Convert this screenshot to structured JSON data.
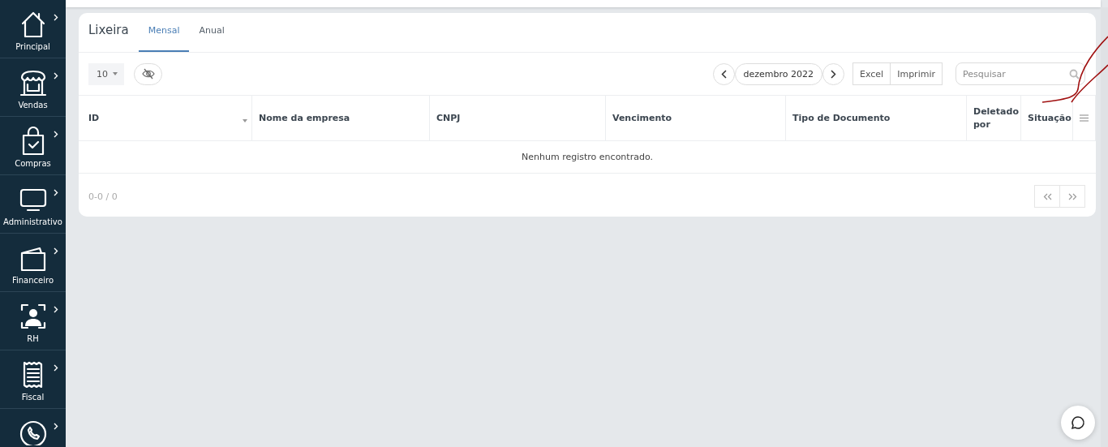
{
  "sidebar": {
    "items": [
      {
        "label": "Principal"
      },
      {
        "label": "Vendas"
      },
      {
        "label": "Compras"
      },
      {
        "label": "Administrativo"
      },
      {
        "label": "Financeiro"
      },
      {
        "label": "RH"
      },
      {
        "label": "Fiscal"
      }
    ]
  },
  "card": {
    "title": "Lixeira",
    "tabs": [
      {
        "label": "Mensal",
        "selected": true
      },
      {
        "label": "Anual",
        "selected": false
      }
    ]
  },
  "toolbar": {
    "page_size": "10",
    "period": "dezembro 2022",
    "buttons": [
      "Excel",
      "Imprimir"
    ],
    "search": {
      "placeholder": "Pesquisar"
    }
  },
  "table": {
    "columns": [
      "ID",
      "Nome da empresa",
      "CNPJ",
      "Vencimento",
      "Tipo de Documento",
      "Deletado por",
      "Situação"
    ],
    "empty": "Nenhum registro encontrado."
  },
  "footer": {
    "range": "0-0 / 0"
  }
}
